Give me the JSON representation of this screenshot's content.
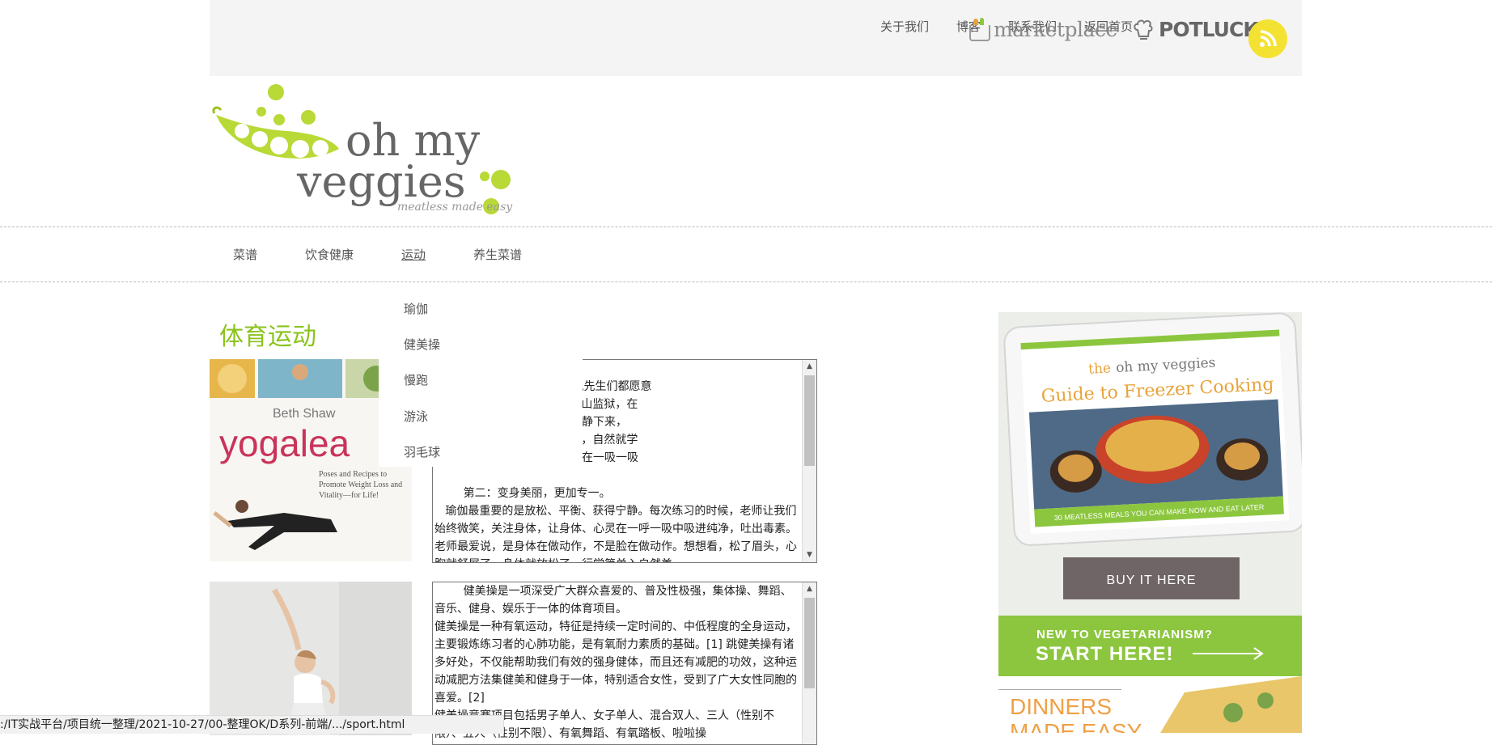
{
  "top_nav": {
    "links": [
      "关于我们",
      "博客",
      "联系我们",
      "返回首页"
    ],
    "marketplace_label": "marketplace",
    "potluck_label": "POTLUCK",
    "rss_icon": "rss-icon"
  },
  "logo": {
    "line1": "oh my",
    "line2": "veggies",
    "tagline": "meatless made easy"
  },
  "main_nav": {
    "items": [
      "菜谱",
      "饮食健康",
      "运动",
      "养生菜谱"
    ],
    "active": "运动"
  },
  "dropdown": {
    "items": [
      "瑜伽",
      "健美操",
      "慢跑",
      "游泳",
      "羽毛球"
    ]
  },
  "section_title": "体育运动",
  "cards": [
    {
      "image": {
        "author": "Beth Shaw",
        "title": "yogalea",
        "subtitle": "Poses and Recipes to Promote Weight Loss and Vitality—for Life!"
      },
      "text": "          瑜伽馆的老师们总是说先生们都愿意\n变了火爆脾气。   而美国旧金山监狱，在\n瑜伽和戏剧治疗，帮助他们冷静下来，\n侵略性的原因。   多做深呼吸，自然就学\n麻花，竞技动作的难度，而是在一吸一吸\n\n        第二：变身美丽，更加专一。\n   瑜伽最重要的是放松、平衡、获得宁静。每次练习的时候，老师让我们始终微笑，关注身体，让身体、心灵在一呼一吸中吸进纯净，吐出毒素。老师最爱说，是身体在做动作，不是脸在做动作。想想看，松了眉头，心胸就舒展了，身体就放松了，行学简单入自然美"
    },
    {
      "text": "        健美操是一项深受广大群众喜爱的、普及性极强，集体操、舞蹈、音乐、健身、娱乐于一体的体育项目。\n健美操是一种有氧运动，特征是持续一定时间的、中低程度的全身运动，主要锻炼练习者的心肺功能，是有氧耐力素质的基础。[1] 跳健美操有诸多好处，不仅能帮助我们有效的强身健体，而且还有减肥的功效，这种运动减肥方法集健美和健身于一体，特别适合女性，受到了广大女性同胞的喜爱。[2]\n健美操竞赛项目包括男子单人、女子单人、混合双人、三人（性别不限）、五人（性别不限）、有氧舞蹈、有氧踏板、啦啦操"
    }
  ],
  "sidebar_ad": {
    "brand_prefix": "the",
    "brand": "oh my veggies",
    "title": "Guide to Freezer Cooking",
    "ribbon": "30 MEATLESS MEALS YOU CAN MAKE NOW AND EAT LATER",
    "buy_button": "BUY IT HERE",
    "banner_line1": "NEW TO VEGETARIANISM?",
    "banner_line2": "START HERE!",
    "bottom_line1": "DINNERS",
    "bottom_line2": "MADE EASY"
  },
  "status_bar": {
    "url": ":/IT实战平台/项目统一整理/2021-10-27/00-整理OK/D系列-前端/.../sport.html"
  },
  "colors": {
    "accent_green": "#8ac31c",
    "topbar_bg": "#f4f4f4",
    "rss_yellow": "#f4e233",
    "buy_button_bg": "#6f6566",
    "banner_green": "#8cc63f",
    "dinners_orange": "#f0a045"
  }
}
